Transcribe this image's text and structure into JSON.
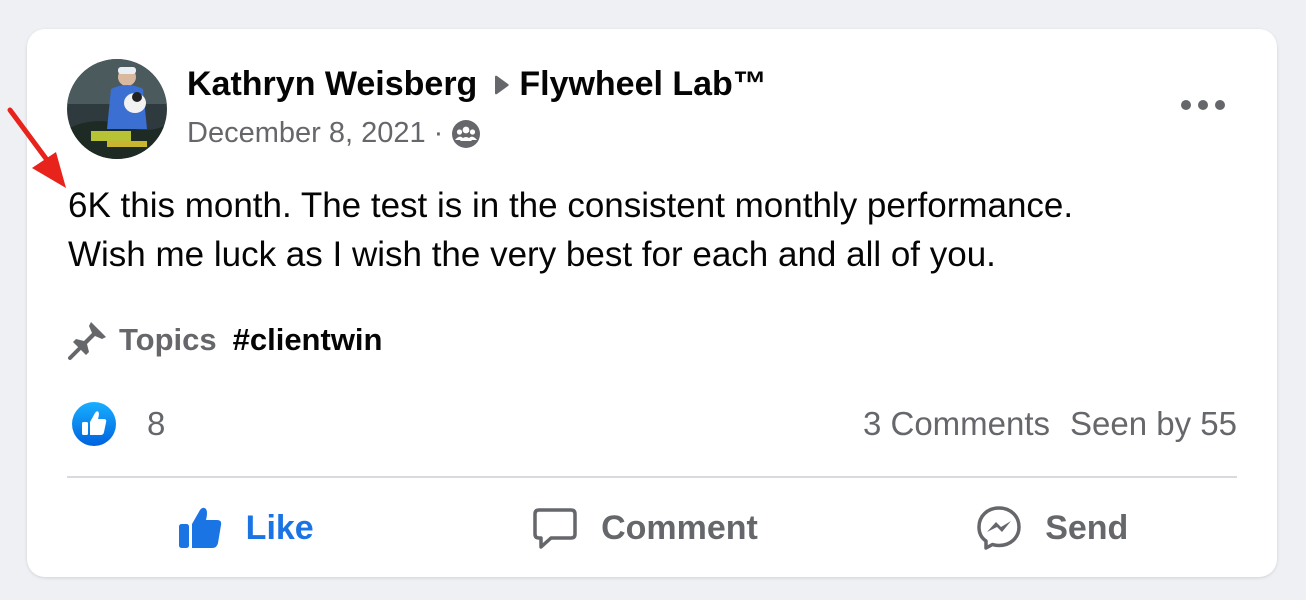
{
  "post": {
    "author": "Kathryn Weisberg",
    "group": "Flywheel Lab™",
    "date": "December 8, 2021",
    "separator": "·",
    "audience_icon": "group-audience-icon",
    "text_line1": "6K this month. The test is in the consistent monthly performance.",
    "text_line2": "Wish me luck as I wish the very best for each and all of you."
  },
  "topics": {
    "label": "Topics",
    "tag": "#clientwin"
  },
  "stats": {
    "reaction_count": "8",
    "comments": "3 Comments",
    "seen_by": "Seen by 55"
  },
  "actions": {
    "like": "Like",
    "comment": "Comment",
    "send": "Send"
  },
  "colors": {
    "accent": "#1b74e4",
    "text": "#050505",
    "muted": "#65676b",
    "annotation": "#e8231b"
  }
}
